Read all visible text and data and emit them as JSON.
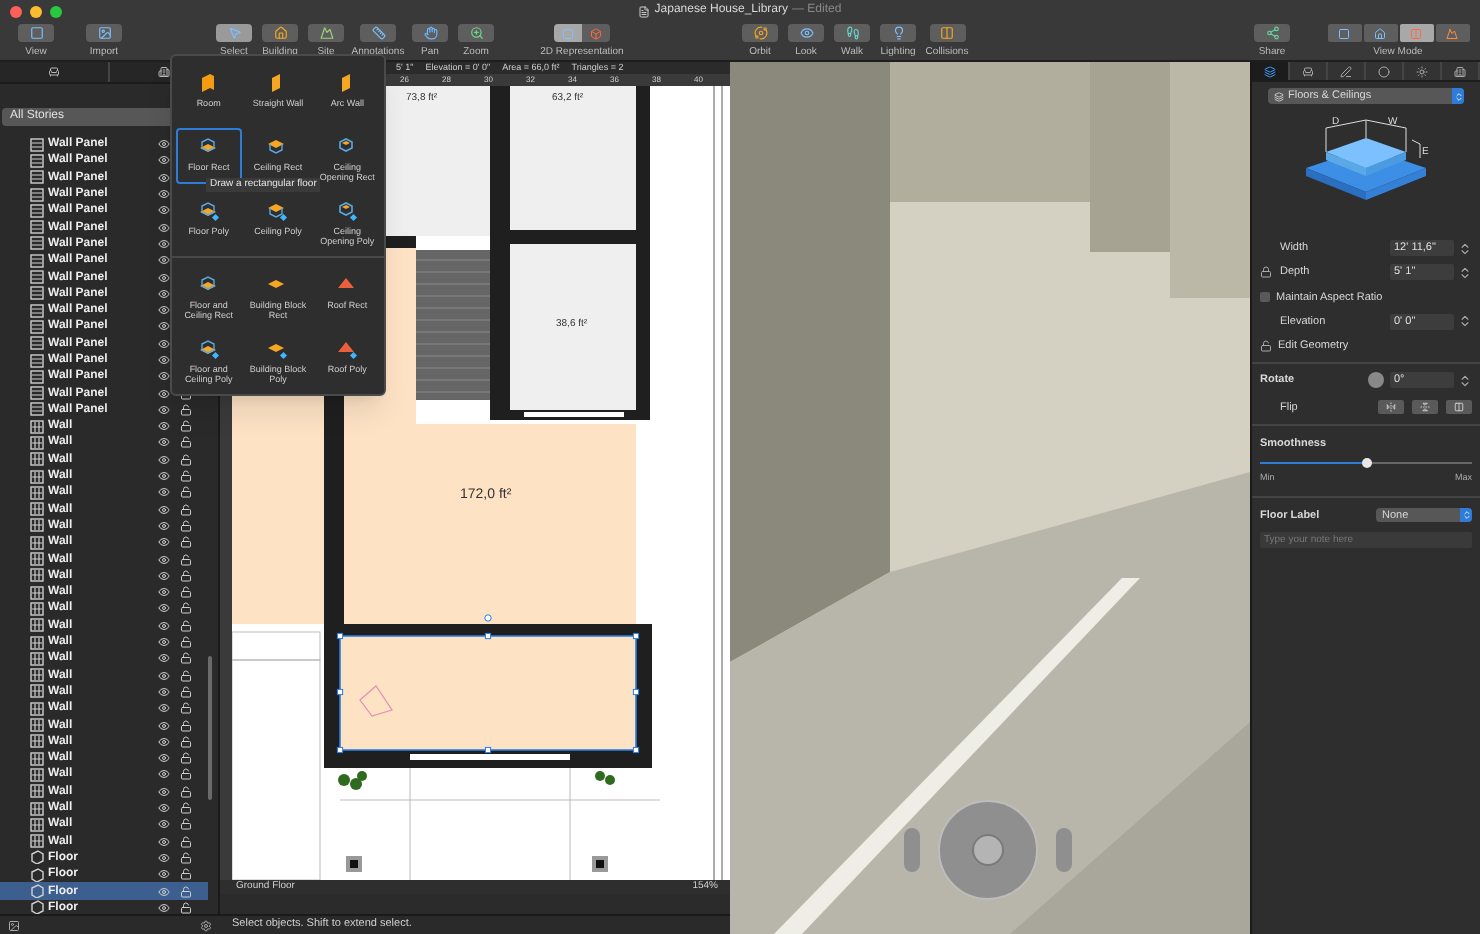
{
  "window": {
    "title": "Japanese House_Library",
    "status": "— Edited"
  },
  "toolbar": {
    "left": [
      {
        "label": "View"
      },
      {
        "label": "Import"
      }
    ],
    "tools": [
      {
        "label": "Select",
        "selected": true
      },
      {
        "label": "Building",
        "selected": false
      },
      {
        "label": "Site",
        "selected": false
      },
      {
        "label": "Annotations",
        "selected": false
      },
      {
        "label": "Pan",
        "selected": false
      },
      {
        "label": "Zoom",
        "selected": false
      }
    ],
    "representation": {
      "label": "2D Representation",
      "segments": [
        {
          "selected": true
        },
        {
          "selected": false
        }
      ]
    },
    "view_tools": [
      {
        "label": "Orbit"
      },
      {
        "label": "Look"
      },
      {
        "label": "Walk"
      },
      {
        "label": "Lighting"
      },
      {
        "label": "Collisions"
      }
    ],
    "share": {
      "label": "Share"
    },
    "view_mode": {
      "label": "View Mode",
      "segments": [
        {
          "selected": false
        },
        {
          "selected": false
        },
        {
          "selected": true
        },
        {
          "selected": false
        }
      ]
    }
  },
  "sidebar": {
    "story_filter": "All Stories",
    "items": [
      {
        "label": "Wall Panel",
        "kind": "wall-panel",
        "selected": false
      },
      {
        "label": "Wall Panel",
        "kind": "wall-panel",
        "selected": false
      },
      {
        "label": "Wall Panel",
        "kind": "wall-panel",
        "selected": false
      },
      {
        "label": "Wall Panel",
        "kind": "wall-panel",
        "selected": false
      },
      {
        "label": "Wall Panel",
        "kind": "wall-panel",
        "selected": false
      },
      {
        "label": "Wall Panel",
        "kind": "wall-panel",
        "selected": false
      },
      {
        "label": "Wall Panel",
        "kind": "wall-panel",
        "selected": false
      },
      {
        "label": "Wall Panel",
        "kind": "wall-panel",
        "selected": false
      },
      {
        "label": "Wall Panel",
        "kind": "wall-panel",
        "selected": false
      },
      {
        "label": "Wall Panel",
        "kind": "wall-panel",
        "selected": false
      },
      {
        "label": "Wall Panel",
        "kind": "wall-panel",
        "selected": false
      },
      {
        "label": "Wall Panel",
        "kind": "wall-panel",
        "selected": false
      },
      {
        "label": "Wall Panel",
        "kind": "wall-panel",
        "selected": false
      },
      {
        "label": "Wall Panel",
        "kind": "wall-panel",
        "selected": false
      },
      {
        "label": "Wall Panel",
        "kind": "wall-panel",
        "selected": false
      },
      {
        "label": "Wall Panel",
        "kind": "wall-panel",
        "selected": false
      },
      {
        "label": "Wall Panel",
        "kind": "wall-panel",
        "selected": false
      },
      {
        "label": "Wall",
        "kind": "wall",
        "selected": false
      },
      {
        "label": "Wall",
        "kind": "wall",
        "selected": false
      },
      {
        "label": "Wall",
        "kind": "wall",
        "selected": false
      },
      {
        "label": "Wall",
        "kind": "wall",
        "selected": false
      },
      {
        "label": "Wall",
        "kind": "wall",
        "selected": false
      },
      {
        "label": "Wall",
        "kind": "wall",
        "selected": false
      },
      {
        "label": "Wall",
        "kind": "wall",
        "selected": false
      },
      {
        "label": "Wall",
        "kind": "wall",
        "selected": false
      },
      {
        "label": "Wall",
        "kind": "wall",
        "selected": false
      },
      {
        "label": "Wall",
        "kind": "wall",
        "selected": false
      },
      {
        "label": "Wall",
        "kind": "wall",
        "selected": false
      },
      {
        "label": "Wall",
        "kind": "wall",
        "selected": false
      },
      {
        "label": "Wall",
        "kind": "wall",
        "selected": false
      },
      {
        "label": "Wall",
        "kind": "wall",
        "selected": false
      },
      {
        "label": "Wall",
        "kind": "wall",
        "selected": false
      },
      {
        "label": "Wall",
        "kind": "wall",
        "selected": false
      },
      {
        "label": "Wall",
        "kind": "wall",
        "selected": false
      },
      {
        "label": "Wall",
        "kind": "wall",
        "selected": false
      },
      {
        "label": "Wall",
        "kind": "wall",
        "selected": false
      },
      {
        "label": "Wall",
        "kind": "wall",
        "selected": false
      },
      {
        "label": "Wall",
        "kind": "wall",
        "selected": false
      },
      {
        "label": "Wall",
        "kind": "wall",
        "selected": false
      },
      {
        "label": "Wall",
        "kind": "wall",
        "selected": false
      },
      {
        "label": "Wall",
        "kind": "wall",
        "selected": false
      },
      {
        "label": "Wall",
        "kind": "wall",
        "selected": false
      },
      {
        "label": "Wall",
        "kind": "wall",
        "selected": false
      },
      {
        "label": "Floor",
        "kind": "floor",
        "selected": false
      },
      {
        "label": "Floor",
        "kind": "floor",
        "selected": false
      },
      {
        "label": "Floor",
        "kind": "floor",
        "selected": true
      },
      {
        "label": "Floor",
        "kind": "floor",
        "selected": false
      }
    ]
  },
  "build_menu": {
    "sections": [
      [
        {
          "label": "Room",
          "kind": "room",
          "poly": false,
          "selected": false
        },
        {
          "label": "Straight Wall",
          "kind": "wall",
          "poly": false,
          "selected": false
        },
        {
          "label": "Arc Wall",
          "kind": "wall",
          "poly": false,
          "selected": false
        },
        {
          "label": "Floor Rect",
          "kind": "floor",
          "poly": false,
          "selected": true
        },
        {
          "label": "Ceiling Rect",
          "kind": "ceiling",
          "poly": false,
          "selected": false
        },
        {
          "label": "Ceiling Opening Rect",
          "kind": "opening",
          "poly": false,
          "selected": false
        },
        {
          "label": "Floor Poly",
          "kind": "floor",
          "poly": true,
          "selected": false
        },
        {
          "label": "Ceiling Poly",
          "kind": "ceiling",
          "poly": true,
          "selected": false
        },
        {
          "label": "Ceiling Opening Poly",
          "kind": "opening",
          "poly": true,
          "selected": false
        }
      ],
      [
        {
          "label": "Floor and Ceiling Rect",
          "kind": "floor",
          "poly": false,
          "selected": false
        },
        {
          "label": "Building Block Rect",
          "kind": "block",
          "poly": false,
          "selected": false
        },
        {
          "label": "Roof Rect",
          "kind": "roof",
          "poly": false,
          "selected": false
        },
        {
          "label": "Floor and Ceiling Poly",
          "kind": "floor",
          "poly": true,
          "selected": false
        },
        {
          "label": "Building Block Poly",
          "kind": "block",
          "poly": true,
          "selected": false
        },
        {
          "label": "Roof Poly",
          "kind": "roof",
          "poly": true,
          "selected": false
        }
      ]
    ],
    "tooltip": "Draw a rectangular floor"
  },
  "plan": {
    "info": [
      "5' 1\"",
      "Elevation = 0' 0\"",
      "Area = 66,0 ft²",
      "Triangles = 2"
    ],
    "ruler": [
      "26",
      "28",
      "30",
      "32",
      "34",
      "36",
      "38",
      "40"
    ],
    "rooms": [
      {
        "area": "73,8 ft²"
      },
      {
        "area": "63,2 ft²"
      },
      {
        "area": "38,6 ft²"
      },
      {
        "area": "172,0 ft²"
      }
    ],
    "story": "Ground Floor",
    "zoom": "154%"
  },
  "inspector": {
    "tabs": [
      {
        "selected": true
      },
      {
        "selected": false
      },
      {
        "selected": false
      },
      {
        "selected": false
      },
      {
        "selected": false
      },
      {
        "selected": false
      }
    ],
    "category": "Floors & Ceilings",
    "diagram_labels": [
      "D",
      "W",
      "E"
    ],
    "width": {
      "label": "Width",
      "value": "12' 11,6\""
    },
    "depth": {
      "label": "Depth",
      "value": "5' 1\""
    },
    "aspect": {
      "label": "Maintain Aspect Ratio",
      "checked": false
    },
    "elevation": {
      "label": "Elevation",
      "value": "0' 0\""
    },
    "edit_geometry": "Edit Geometry",
    "rotate": {
      "label": "Rotate",
      "value": "0°"
    },
    "flip": "Flip",
    "smoothness": {
      "label": "Smoothness",
      "level": 0.5,
      "min": "Min",
      "max": "Max"
    },
    "floor_label": {
      "label": "Floor Label",
      "value": "None",
      "placeholder": "Type your note here"
    }
  },
  "status_bar": "Select objects. Shift to extend select."
}
